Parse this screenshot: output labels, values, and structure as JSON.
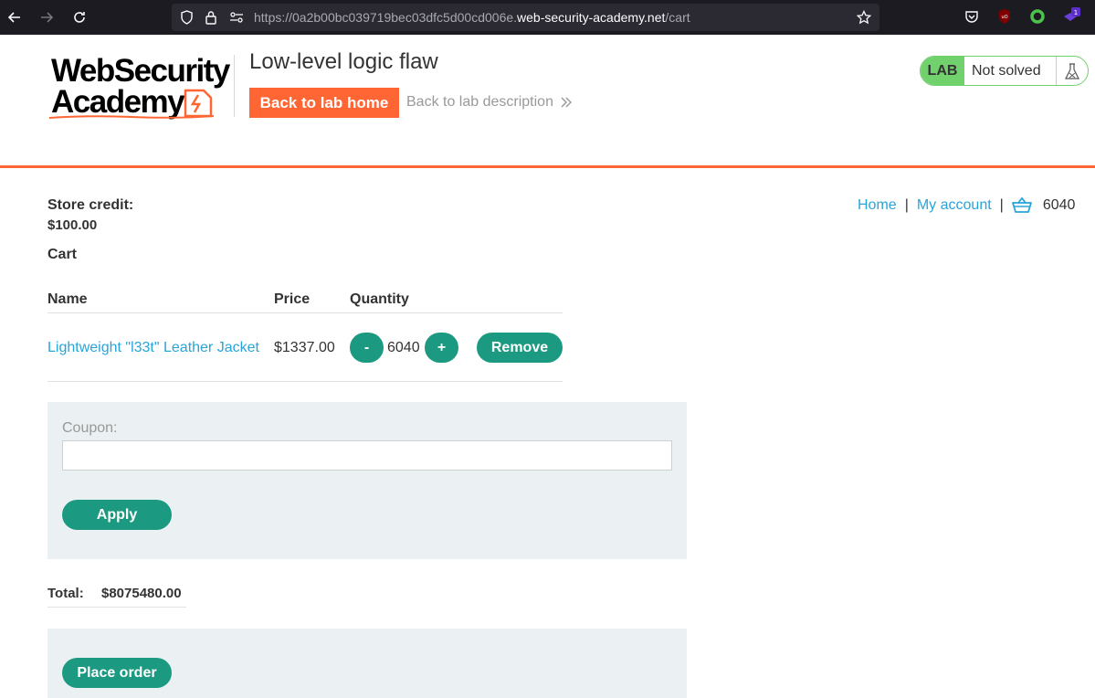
{
  "browser": {
    "url_prefix": "https://0a2b00bc039719bec03dfc5d00cd006e.",
    "url_domain": "web-security-academy.net",
    "url_path": "/cart",
    "extension_badge": "1"
  },
  "header": {
    "logo_line1": "WebSecurity",
    "logo_line2": "Academy",
    "lab_title": "Low-level logic flaw",
    "back_home": "Back to lab home",
    "back_description": "Back to lab description",
    "lab_badge": "LAB",
    "lab_state": "Not solved"
  },
  "nav": {
    "home": "Home",
    "separator": "|",
    "my_account": "My account",
    "cart_count": "6040"
  },
  "store_credit": {
    "label": "Store credit:",
    "value": "$100.00"
  },
  "cart": {
    "heading": "Cart",
    "columns": [
      "Name",
      "Price",
      "Quantity"
    ],
    "items": [
      {
        "name": "Lightweight \"l33t\" Leather Jacket",
        "price": "$1337.00",
        "quantity": "6040",
        "decrement": "-",
        "increment": "+",
        "remove": "Remove"
      }
    ]
  },
  "coupon": {
    "label": "Coupon:",
    "value": "",
    "apply": "Apply"
  },
  "total": {
    "label": "Total:",
    "value": "$8075480.00"
  },
  "order": {
    "place_order": "Place order"
  },
  "colors": {
    "accent_orange": "#ff6633",
    "button_green": "#1b9a81",
    "link_blue": "#29a4d9",
    "lab_green": "#70d16d",
    "panel_grey": "#ebf0f2"
  }
}
